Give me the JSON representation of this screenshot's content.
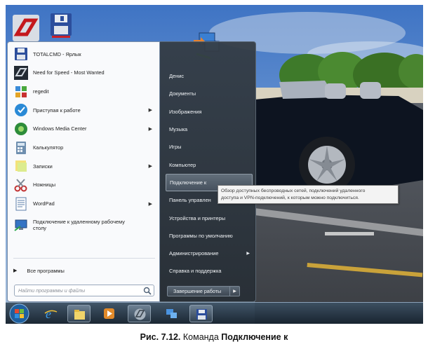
{
  "colors": {
    "start_menu_left_bg": "#f9fafc",
    "start_menu_right_bg": "#343c44",
    "taskbar_bg": "#24303c",
    "tooltip_bg": "#f3f3f3",
    "highlight_border": "#c8d2dc"
  },
  "desktop": {
    "icons": [
      {
        "icon": "need-for-speed-icon"
      },
      {
        "icon": "totalcmd-floppy-icon"
      },
      {
        "icon": "network-computers-icon"
      }
    ]
  },
  "start_menu": {
    "programs": [
      {
        "label": "TOTALCMD - Ярлык",
        "icon": "floppy-icon",
        "has_submenu": false
      },
      {
        "label": "Need for Speed - Most Wanted",
        "icon": "need-for-speed-icon",
        "has_submenu": false
      },
      {
        "label": "regedit",
        "icon": "regedit-icon",
        "has_submenu": false
      },
      {
        "label": "Приступая к работе",
        "icon": "getting-started-icon",
        "has_submenu": true
      },
      {
        "label": "Windows Media Center",
        "icon": "media-center-icon",
        "has_submenu": true
      },
      {
        "label": "Калькулятор",
        "icon": "calculator-icon",
        "has_submenu": false
      },
      {
        "label": "Записки",
        "icon": "sticky-notes-icon",
        "has_submenu": true
      },
      {
        "label": "Ножницы",
        "icon": "scissors-icon",
        "has_submenu": false
      },
      {
        "label": "WordPad",
        "icon": "wordpad-icon",
        "has_submenu": true
      },
      {
        "label_line1": "Подключение к удаленному рабочему",
        "label_line2": "столу",
        "icon": "remote-desktop-icon",
        "has_submenu": false
      }
    ],
    "all_programs_label": "Все программы",
    "search_placeholder": "Найти программы и файлы",
    "right_items": [
      {
        "label": "Денис",
        "has_submenu": false
      },
      {
        "label": "Документы",
        "has_submenu": false
      },
      {
        "label": "Изображения",
        "has_submenu": false
      },
      {
        "label": "Музыка",
        "has_submenu": false
      },
      {
        "label": "Игры",
        "has_submenu": false
      },
      {
        "label": "Компьютер",
        "has_submenu": false
      },
      {
        "label": "Подключение к",
        "has_submenu": false,
        "highlighted": true
      },
      {
        "label": "Панель управлен",
        "has_submenu": false
      },
      {
        "label": "Устройства и принтеры",
        "has_submenu": false
      },
      {
        "label": "Программы по умолчанию",
        "has_submenu": false
      },
      {
        "label": "Администрирование",
        "has_submenu": true
      },
      {
        "label": "Справка и поддержка",
        "has_submenu": false
      }
    ],
    "shutdown_label": "Завершение работы"
  },
  "tooltip": {
    "line1": "Обзор доступных беспроводных сетей, подключений удаленного",
    "line2": "доступа и VPN-подключений, к которым можно подключиться."
  },
  "taskbar": {
    "buttons": [
      {
        "icon": "internet-explorer-icon",
        "active": false
      },
      {
        "icon": "file-manager-icon",
        "active": true
      },
      {
        "icon": "media-player-icon",
        "active": false
      },
      {
        "icon": "nfs-game-icon",
        "active": true
      },
      {
        "icon": "network-icon",
        "active": false
      },
      {
        "icon": "totalcmd-icon",
        "active": true
      }
    ]
  },
  "caption": {
    "prefix": "Рис. 7.12.",
    "middle": " Команда ",
    "bold_text": "Подключение к"
  }
}
